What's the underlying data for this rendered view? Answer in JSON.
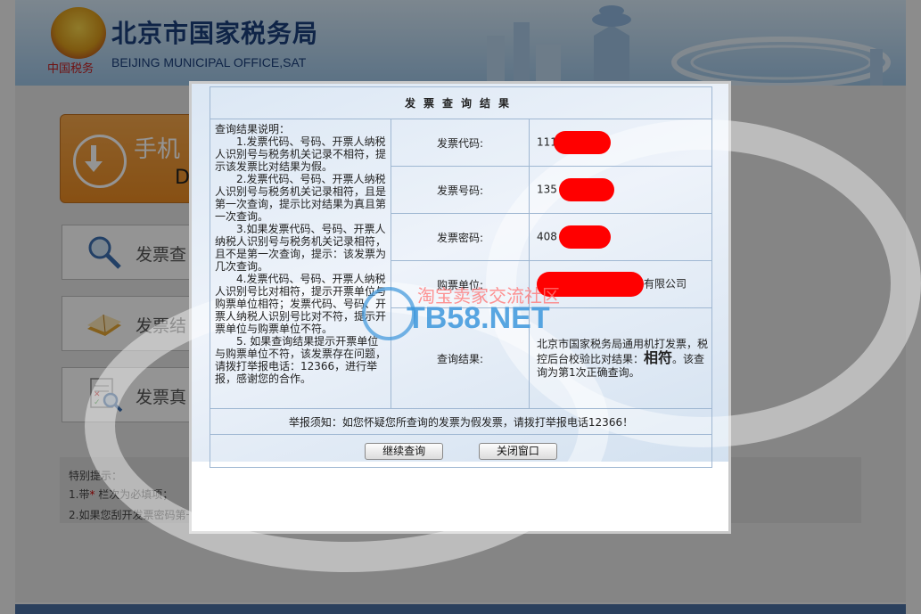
{
  "header": {
    "title": "北京市国家税务局",
    "subtitle": "BEIJING MUNICIPAL OFFICE,SAT",
    "emblem_caption": "中国税务"
  },
  "sidebar": {
    "download_button": {
      "line1": "手机",
      "line2": "D"
    },
    "items": [
      {
        "label": "发票查",
        "icon": "magnifier-icon"
      },
      {
        "label": "发票结",
        "icon": "book-icon"
      },
      {
        "label": "发票真",
        "icon": "document-search-icon"
      }
    ]
  },
  "hint": {
    "title": "特别提示：",
    "line1_prefix": "1.带",
    "line1_star": "*",
    "line1_suffix": " 栏次为必填项；",
    "line2": "2.如果您刮开发票密码第一"
  },
  "modal": {
    "title": "发票查询结果",
    "explain": {
      "heading": "查询结果说明：",
      "items": [
        "1.发票代码、号码、开票人纳税人识别号与税务机关记录不相符，提示该发票比对结果为假。",
        "2.发票代码、号码、开票人纳税人识别号与税务机关记录相符，且是第一次查询，提示比对结果为真且第一次查询。",
        "3.如果发票代码、号码、开票人纳税人识别号与税务机关记录相符，且不是第一次查询，提示：该发票为几次查询。",
        "4.发票代码、号码、开票人纳税人识别号比对相符，提示开票单位与购票单位相符；发票代码、号码、开票人纳税人识别号比对不符，提示开票单位与购票单位不符。",
        "5. 如果查询结果提示开票单位与购票单位不符，该发票存在问题，请拨打举报电话：12366，进行举报，感谢您的合作。"
      ]
    },
    "rows": [
      {
        "label": "发票代码:",
        "value": "111"
      },
      {
        "label": "发票号码:",
        "value": "135"
      },
      {
        "label": "发票密码:",
        "value": "408"
      },
      {
        "label": "购票单位:",
        "value": "有限公司"
      }
    ],
    "result": {
      "label": "查询结果:",
      "text_before": "北京市国家税务局通用机打发票，税控后台校验比对结果：",
      "highlight": "相符",
      "text_after": "。该查询为第1次正确查询。"
    },
    "warning": "举报须知：如您怀疑您所查询的发票为假发票，请拨打举报电话12366！",
    "buttons": {
      "continue": "继续查询",
      "close": "关闭窗口"
    }
  },
  "watermark": {
    "line1": "淘宝卖家交流社区",
    "line2": "TB58.NET"
  },
  "colors": {
    "accent_red": "#d00000",
    "border_blue": "#9fb7d2",
    "header_blue": "#1b3f7a"
  }
}
